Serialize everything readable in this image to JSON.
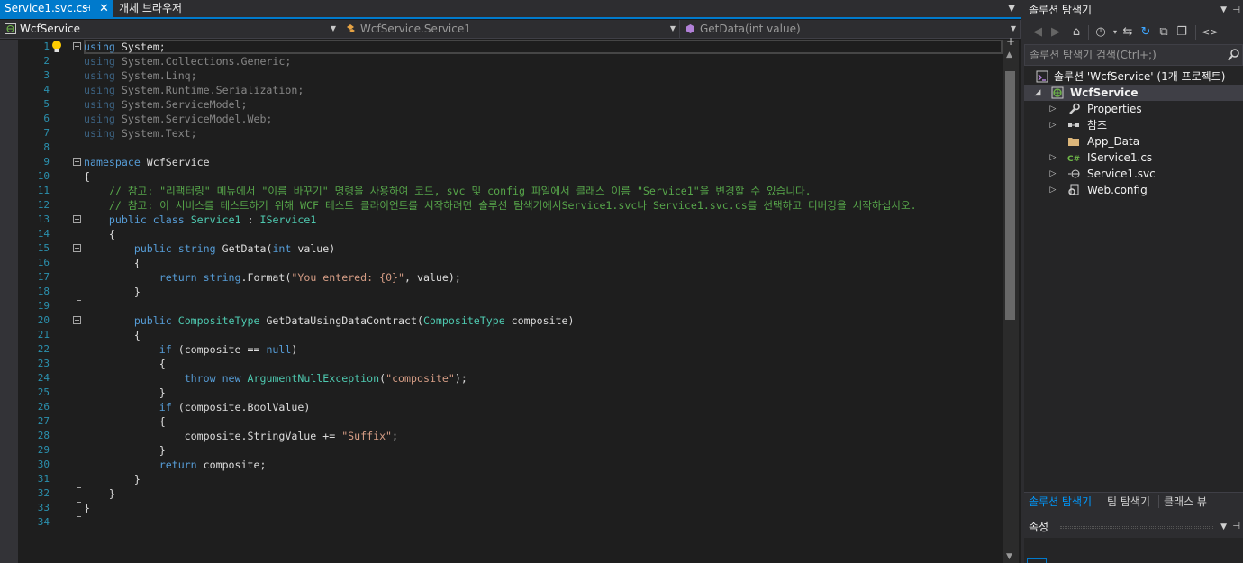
{
  "tabs": {
    "active": "Service1.svc.cs",
    "second": "개체 브라우저"
  },
  "nav": {
    "project": "WcfService",
    "class": "WcfService.Service1",
    "member": "GetData(int value)"
  },
  "editor": {
    "line_numbers": [
      "1",
      "2",
      "3",
      "4",
      "5",
      "6",
      "7",
      "8",
      "9",
      "10",
      "11",
      "12",
      "13",
      "14",
      "15",
      "16",
      "17",
      "18",
      "19",
      "20",
      "21",
      "22",
      "23",
      "24",
      "25",
      "26",
      "27",
      "28",
      "29",
      "30",
      "31",
      "32",
      "33",
      "34"
    ],
    "lines": [
      [
        {
          "t": "using",
          "c": "kw"
        },
        {
          "t": " System;"
        }
      ],
      [
        {
          "t": "using",
          "c": "kw dim"
        },
        {
          "t": " System.Collections.Generic;",
          "c": "dim"
        }
      ],
      [
        {
          "t": "using",
          "c": "kw dim"
        },
        {
          "t": " System.Linq;",
          "c": "dim"
        }
      ],
      [
        {
          "t": "using",
          "c": "kw dim"
        },
        {
          "t": " System.Runtime.Serialization;",
          "c": "dim"
        }
      ],
      [
        {
          "t": "using",
          "c": "kw dim"
        },
        {
          "t": " System.ServiceModel;",
          "c": "dim"
        }
      ],
      [
        {
          "t": "using",
          "c": "kw dim"
        },
        {
          "t": " System.ServiceModel.Web;",
          "c": "dim"
        }
      ],
      [
        {
          "t": "using",
          "c": "kw dim"
        },
        {
          "t": " System.Text;",
          "c": "dim"
        }
      ],
      [],
      [
        {
          "t": "namespace",
          "c": "kw"
        },
        {
          "t": " WcfService"
        }
      ],
      [
        {
          "t": "{"
        }
      ],
      [
        {
          "t": "    "
        },
        {
          "t": "// 참고: \"리팩터링\" 메뉴에서 \"이름 바꾸기\" 명령을 사용하여 코드, svc 및 config 파일에서 클래스 이름 \"Service1\"을 변경할 수 있습니다.",
          "c": "cm"
        }
      ],
      [
        {
          "t": "    "
        },
        {
          "t": "// 참고: 이 서비스를 테스트하기 위해 WCF 테스트 클라이언트를 시작하려면 솔루션 탐색기에서Service1.svc나 Service1.svc.cs를 선택하고 디버깅을 시작하십시오.",
          "c": "cm"
        }
      ],
      [
        {
          "t": "    "
        },
        {
          "t": "public",
          "c": "kw"
        },
        {
          "t": " "
        },
        {
          "t": "class",
          "c": "kw"
        },
        {
          "t": " "
        },
        {
          "t": "Service1",
          "c": "ty"
        },
        {
          "t": " : "
        },
        {
          "t": "IService1",
          "c": "ty"
        }
      ],
      [
        {
          "t": "    {"
        }
      ],
      [
        {
          "t": "        "
        },
        {
          "t": "public",
          "c": "kw"
        },
        {
          "t": " "
        },
        {
          "t": "string",
          "c": "kw"
        },
        {
          "t": " GetData("
        },
        {
          "t": "int",
          "c": "kw"
        },
        {
          "t": " value)"
        }
      ],
      [
        {
          "t": "        {"
        }
      ],
      [
        {
          "t": "            "
        },
        {
          "t": "return",
          "c": "kw"
        },
        {
          "t": " "
        },
        {
          "t": "string",
          "c": "kw"
        },
        {
          "t": ".Format("
        },
        {
          "t": "\"You entered: {0}\"",
          "c": "st"
        },
        {
          "t": ", value);"
        }
      ],
      [
        {
          "t": "        }"
        }
      ],
      [],
      [
        {
          "t": "        "
        },
        {
          "t": "public",
          "c": "kw"
        },
        {
          "t": " "
        },
        {
          "t": "CompositeType",
          "c": "ty"
        },
        {
          "t": " GetDataUsingDataContract("
        },
        {
          "t": "CompositeType",
          "c": "ty"
        },
        {
          "t": " composite)"
        }
      ],
      [
        {
          "t": "        {"
        }
      ],
      [
        {
          "t": "            "
        },
        {
          "t": "if",
          "c": "kw"
        },
        {
          "t": " (composite == "
        },
        {
          "t": "null",
          "c": "kw"
        },
        {
          "t": ")"
        }
      ],
      [
        {
          "t": "            {"
        }
      ],
      [
        {
          "t": "                "
        },
        {
          "t": "throw",
          "c": "kw"
        },
        {
          "t": " "
        },
        {
          "t": "new",
          "c": "kw"
        },
        {
          "t": " "
        },
        {
          "t": "ArgumentNullException",
          "c": "ty"
        },
        {
          "t": "("
        },
        {
          "t": "\"composite\"",
          "c": "st"
        },
        {
          "t": ");"
        }
      ],
      [
        {
          "t": "            }"
        }
      ],
      [
        {
          "t": "            "
        },
        {
          "t": "if",
          "c": "kw"
        },
        {
          "t": " (composite.BoolValue)"
        }
      ],
      [
        {
          "t": "            {"
        }
      ],
      [
        {
          "t": "                composite.StringValue += "
        },
        {
          "t": "\"Suffix\"",
          "c": "st"
        },
        {
          "t": ";"
        }
      ],
      [
        {
          "t": "            }"
        }
      ],
      [
        {
          "t": "            "
        },
        {
          "t": "return",
          "c": "kw"
        },
        {
          "t": " composite;"
        }
      ],
      [
        {
          "t": "        }"
        }
      ],
      [
        {
          "t": "    }"
        }
      ],
      [
        {
          "t": "}"
        }
      ],
      []
    ]
  },
  "solution_explorer": {
    "title": "솔루션 탐색기",
    "search_placeholder": "솔루션 탐색기 검색(Ctrl+;)",
    "solution": "솔루션 'WcfService' (1개 프로젝트)",
    "project": "WcfService",
    "items": [
      {
        "label": "Properties",
        "icon": "wrench-icon",
        "expandable": true
      },
      {
        "label": "참조",
        "icon": "references-icon",
        "expandable": true
      },
      {
        "label": "App_Data",
        "icon": "folder-icon",
        "expandable": false
      },
      {
        "label": "IService1.cs",
        "icon": "csharp-file-icon",
        "expandable": true
      },
      {
        "label": "Service1.svc",
        "icon": "service-file-icon",
        "expandable": true
      },
      {
        "label": "Web.config",
        "icon": "config-file-icon",
        "expandable": true
      }
    ],
    "bottom_tabs": [
      "솔루션 탐색기",
      "팀 탐색기",
      "클래스 뷰"
    ]
  },
  "properties": {
    "title": "속성"
  },
  "colors": {
    "accent": "#007acc",
    "keyword": "#569cd6",
    "type": "#4ec9b0",
    "string": "#d69d85",
    "comment": "#57a64a",
    "line_number": "#2b91af"
  }
}
